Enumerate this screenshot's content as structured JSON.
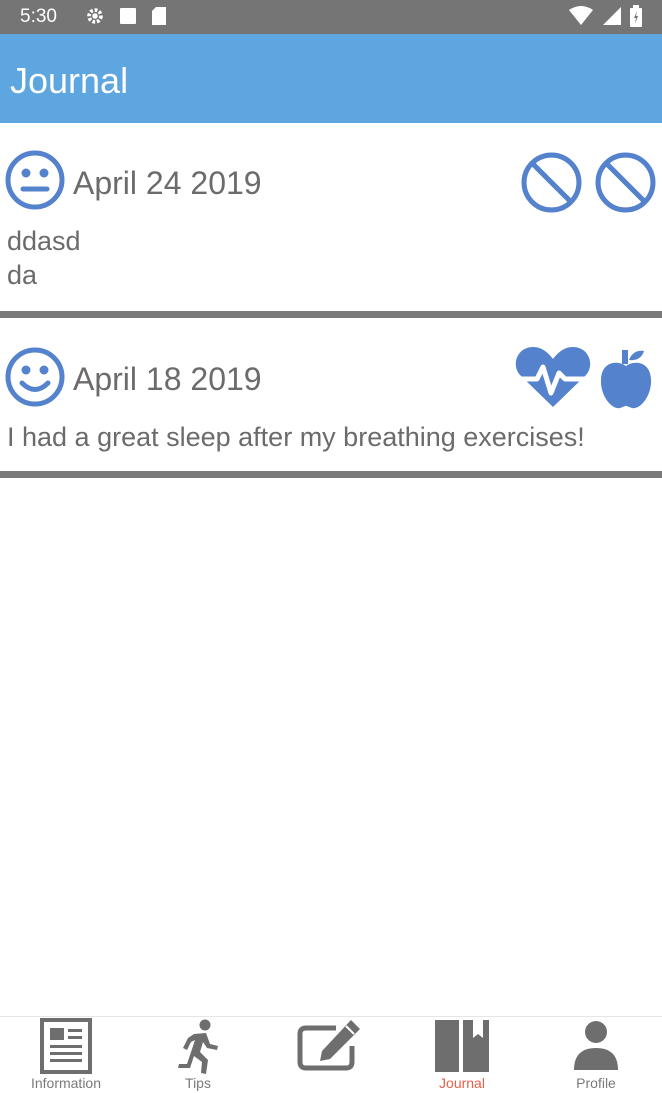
{
  "status_bar": {
    "time": "5:30",
    "left_icons": [
      "settings-gear-icon",
      "notification-square-icon",
      "sd-card-icon"
    ],
    "right_icons": [
      "wifi-icon",
      "signal-icon",
      "battery-icon"
    ]
  },
  "app_bar": {
    "title": "Journal",
    "color": "#5da6e0"
  },
  "entries": [
    {
      "mood": "neutral-face-icon",
      "date": "April 24 2019",
      "text_lines": [
        "ddasd",
        "da"
      ],
      "tags": [
        "none-icon",
        "none-icon"
      ]
    },
    {
      "mood": "smiley-face-icon",
      "date": "April 18 2019",
      "text_lines": [
        "I had a great sleep after my breathing exercises!"
      ],
      "tags": [
        "heart-pulse-icon",
        "apple-icon"
      ]
    }
  ],
  "bottom_nav": {
    "items": [
      {
        "label": "Information",
        "icon": "newspaper-icon",
        "active": false
      },
      {
        "label": "Tips",
        "icon": "running-person-icon",
        "active": false
      },
      {
        "label": "",
        "icon": "edit-pencil-icon",
        "active": false
      },
      {
        "label": "Journal",
        "icon": "book-icon",
        "active": true
      },
      {
        "label": "Profile",
        "icon": "person-icon",
        "active": false
      }
    ],
    "active_color": "#e8604c",
    "inactive_color": "#7a7a7a"
  },
  "colors": {
    "icon_blue": "#5582cc",
    "divider": "#7a7a7a",
    "text_gray": "#6b6b6b"
  }
}
